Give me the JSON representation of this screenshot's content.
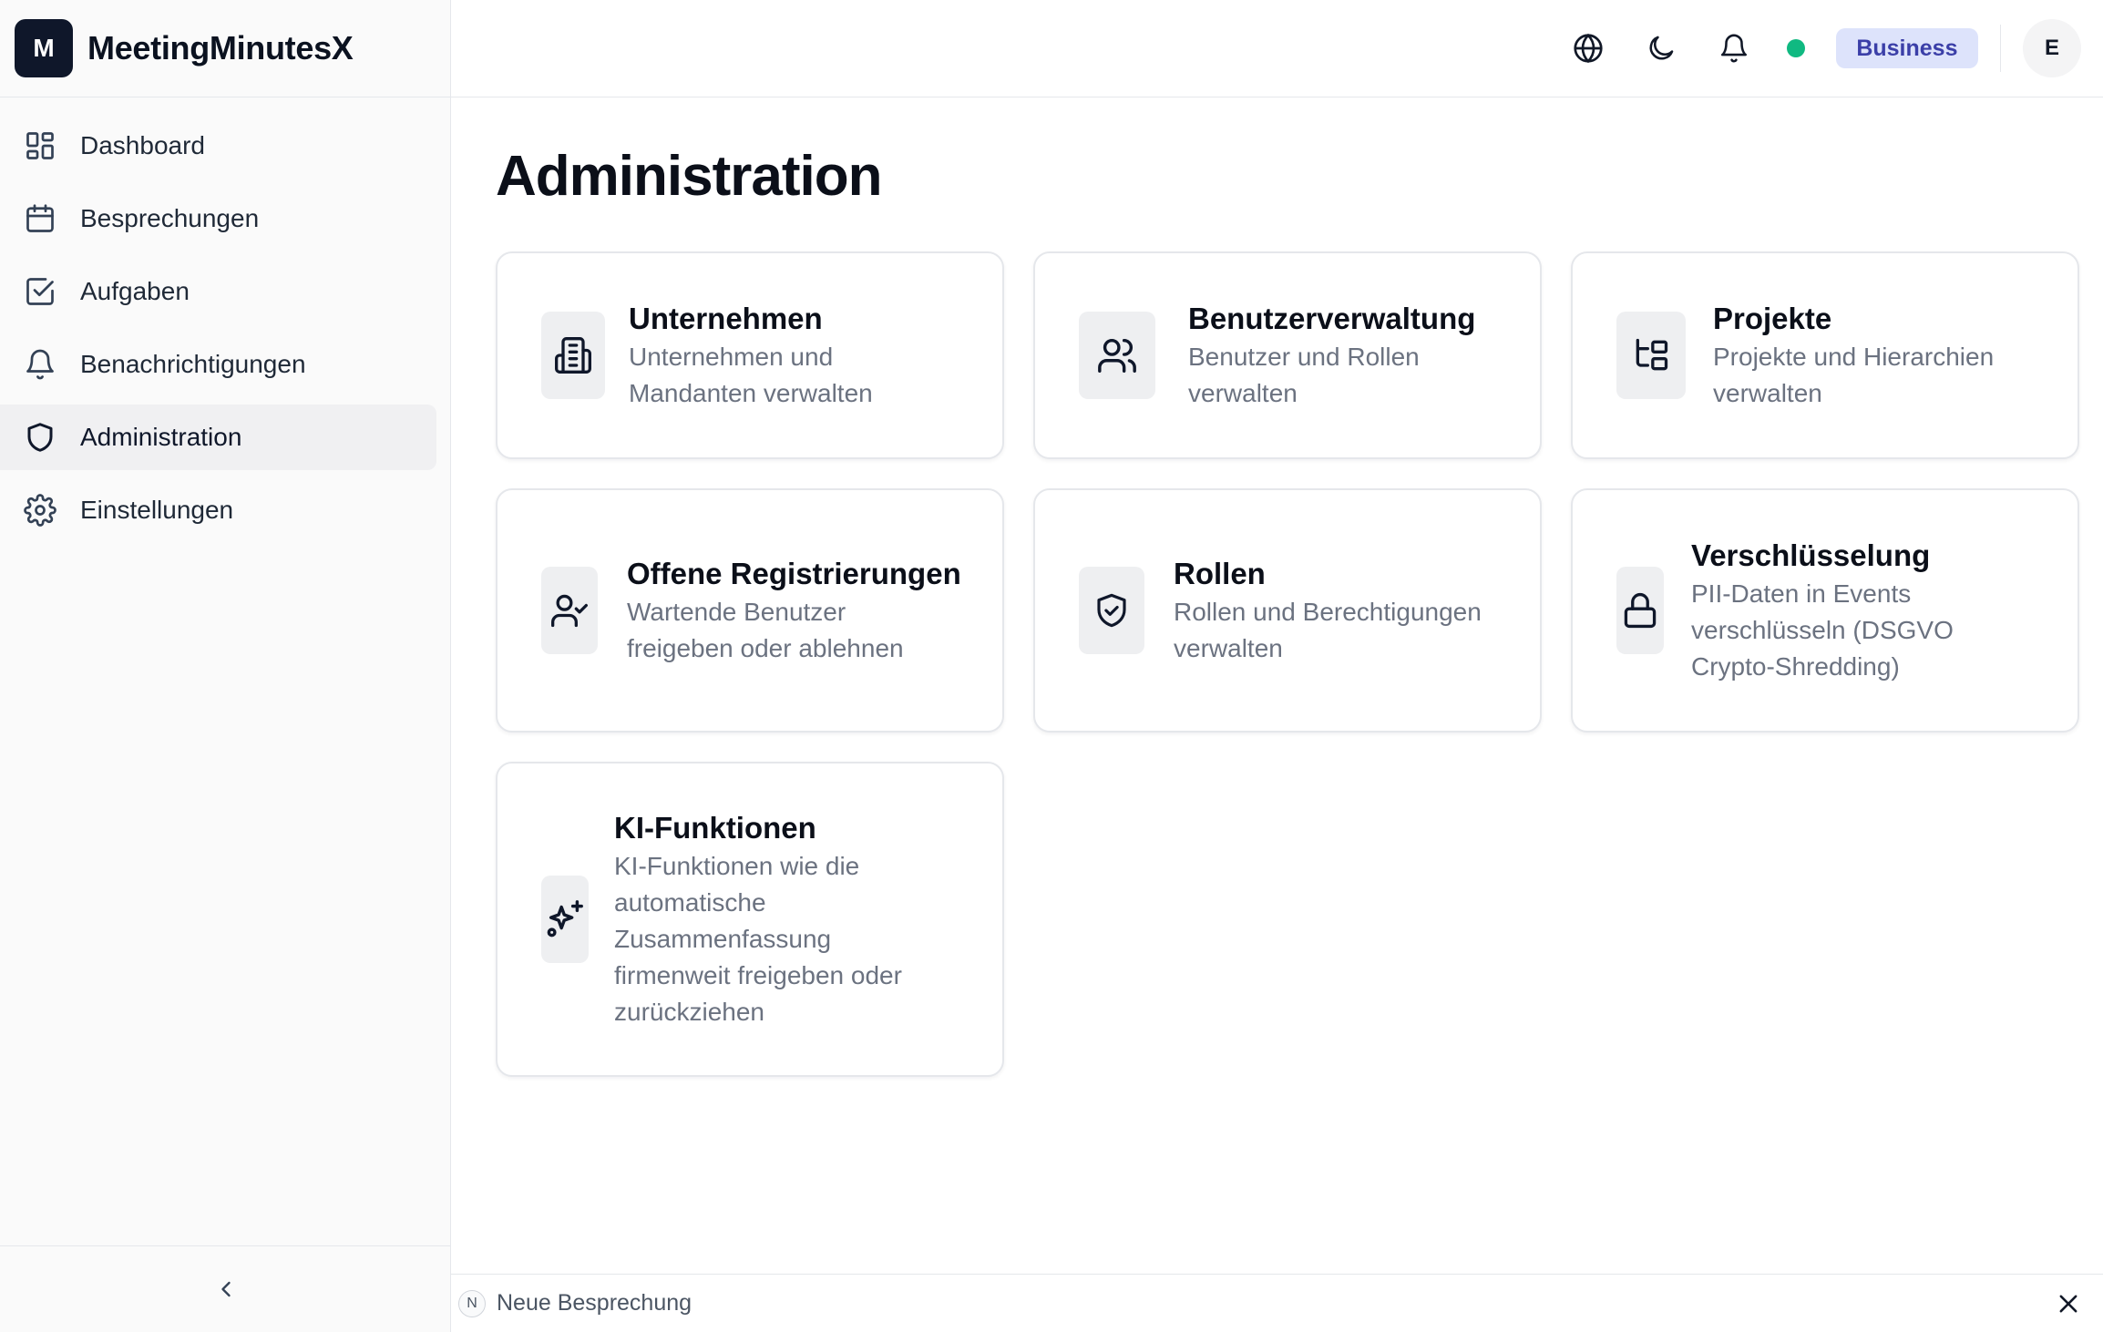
{
  "app": {
    "logo_letter": "M",
    "name": "MeetingMinutesX"
  },
  "sidebar": {
    "items": [
      {
        "label": "Dashboard",
        "icon": "dashboard-icon",
        "active": false
      },
      {
        "label": "Besprechungen",
        "icon": "calendar-icon",
        "active": false
      },
      {
        "label": "Aufgaben",
        "icon": "checkbox-icon",
        "active": false
      },
      {
        "label": "Benachrichtigungen",
        "icon": "bell-icon",
        "active": false
      },
      {
        "label": "Administration",
        "icon": "shield-icon",
        "active": true
      },
      {
        "label": "Einstellungen",
        "icon": "gear-icon",
        "active": false
      }
    ],
    "collapse_icon": "chevron-left-icon"
  },
  "topbar": {
    "icons": [
      "globe-icon",
      "moon-icon",
      "bell-icon"
    ],
    "status_color": "#10b981",
    "plan_badge": "Business",
    "avatar_initial": "E"
  },
  "main": {
    "title": "Administration",
    "cards": [
      {
        "title": "Unternehmen",
        "desc_lines": [
          "Unternehmen und",
          "Mandanten verwalten"
        ],
        "icon": "building-icon"
      },
      {
        "title": "Benutzerverwaltung",
        "desc_lines": [
          "Benutzer und Rollen",
          "verwalten"
        ],
        "icon": "users-icon"
      },
      {
        "title": "Projekte",
        "desc_lines": [
          "Projekte und Hierarchien",
          "verwalten"
        ],
        "icon": "folder-tree-icon"
      },
      {
        "title": "Offene Registrierungen",
        "desc_lines": [
          "Wartende Benutzer",
          "freigeben oder ablehnen"
        ],
        "icon": "user-check-icon"
      },
      {
        "title": "Rollen",
        "desc_lines": [
          "Rollen und Berechtigungen",
          "verwalten"
        ],
        "icon": "shield-check-icon"
      },
      {
        "title": "Verschlüsselung",
        "desc_lines": [
          "PII-Daten in Events",
          "verschlüsseln (DSGVO",
          "Crypto-Shredding)"
        ],
        "icon": "lock-icon"
      },
      {
        "title": "KI-Funktionen",
        "desc_lines": [
          "KI-Funktionen wie die",
          "automatische",
          "Zusammenfassung",
          "firmenweit freigeben oder",
          "zurückziehen"
        ],
        "icon": "sparkles-icon"
      }
    ]
  },
  "bottombar": {
    "shortcut_key": "N",
    "label": "Neue Besprechung",
    "close_icon": "close-icon"
  },
  "colors": {
    "accent_dark": "#0f172a",
    "badge_bg": "#dde3fb",
    "badge_text": "#3b3fa8"
  }
}
